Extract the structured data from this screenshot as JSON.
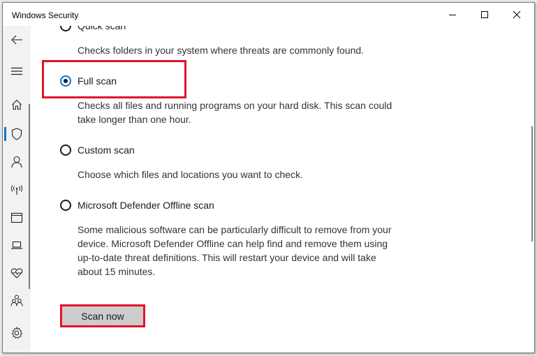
{
  "window": {
    "title": "Windows Security",
    "controls": {
      "minimize": "minimize",
      "maximize": "maximize",
      "close": "close"
    }
  },
  "sidebar": {
    "items": [
      {
        "name": "back",
        "icon": "back-arrow-icon"
      },
      {
        "name": "menu",
        "icon": "hamburger-menu-icon"
      },
      {
        "name": "home",
        "icon": "home-icon"
      },
      {
        "name": "virus-threat-protection",
        "icon": "shield-icon",
        "active": true
      },
      {
        "name": "account-protection",
        "icon": "person-icon"
      },
      {
        "name": "firewall-network-protection",
        "icon": "wireless-antenna-icon"
      },
      {
        "name": "app-browser-control",
        "icon": "browser-window-icon"
      },
      {
        "name": "device-security",
        "icon": "laptop-icon"
      },
      {
        "name": "device-performance-health",
        "icon": "heart-pulse-icon"
      },
      {
        "name": "family-options",
        "icon": "family-icon"
      },
      {
        "name": "settings",
        "icon": "gear-icon"
      }
    ],
    "accent_color": "#0078d7"
  },
  "scan_options": [
    {
      "label": "Quick scan",
      "description": "Checks folders in your system where threats are commonly found.",
      "selected": false
    },
    {
      "label": "Full scan",
      "description": "Checks all files and running programs on your hard disk. This scan could take longer than one hour.",
      "selected": true
    },
    {
      "label": "Custom scan",
      "description": "Choose which files and locations you want to check.",
      "selected": false
    },
    {
      "label": "Microsoft Defender Offline scan",
      "description": "Some malicious software can be particularly difficult to remove from your device. Microsoft Defender Offline can help find and remove them using up-to-date threat definitions. This will restart your device and will take about 15 minutes.",
      "selected": false
    }
  ],
  "scan_button": {
    "label": "Scan now"
  },
  "annotation_color": "#e3132a"
}
